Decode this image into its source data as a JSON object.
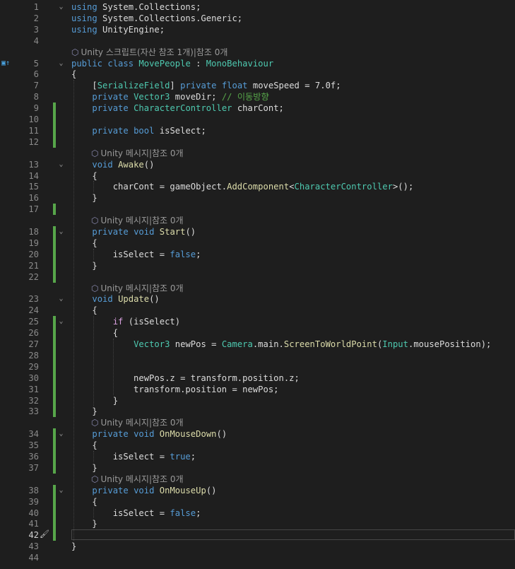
{
  "editor": {
    "current_line": 42,
    "lines": [
      {
        "n": 1,
        "t": [
          [
            "kw",
            "using"
          ],
          [
            "pl",
            " System.Collections;"
          ]
        ]
      },
      {
        "n": 2,
        "t": [
          [
            "kw",
            "using"
          ],
          [
            "pl",
            " System.Collections.Generic;"
          ]
        ]
      },
      {
        "n": 3,
        "t": [
          [
            "kw",
            "using"
          ],
          [
            "pl",
            " UnityEngine;"
          ]
        ]
      },
      {
        "n": 4,
        "t": []
      },
      {
        "lens": "Unity 스크립트(자산 참조 1개)|참조 0개",
        "indent": 0
      },
      {
        "n": 5,
        "t": [
          [
            "kw",
            "public"
          ],
          [
            "pl",
            " "
          ],
          [
            "kw",
            "class"
          ],
          [
            "pl",
            " "
          ],
          [
            "ty",
            "MovePeople"
          ],
          [
            "pl",
            " : "
          ],
          [
            "ty",
            "MonoBehaviour"
          ]
        ]
      },
      {
        "n": 6,
        "t": [
          [
            "pl",
            "{"
          ]
        ]
      },
      {
        "n": 7,
        "t": [
          [
            "pl",
            "    ["
          ],
          [
            "at",
            "SerializeField"
          ],
          [
            "pl",
            "] "
          ],
          [
            "kw",
            "private"
          ],
          [
            "pl",
            " "
          ],
          [
            "kw",
            "float"
          ],
          [
            "pl",
            " moveSpeed = 7.0f;"
          ]
        ]
      },
      {
        "n": 8,
        "t": [
          [
            "pl",
            "    "
          ],
          [
            "kw",
            "private"
          ],
          [
            "pl",
            " "
          ],
          [
            "ty",
            "Vector3"
          ],
          [
            "pl",
            " moveDir; "
          ],
          [
            "cm",
            "// 이동방향"
          ]
        ]
      },
      {
        "n": 9,
        "t": [
          [
            "pl",
            "    "
          ],
          [
            "kw",
            "private"
          ],
          [
            "pl",
            " "
          ],
          [
            "ty",
            "CharacterController"
          ],
          [
            "pl",
            " charCont;"
          ]
        ]
      },
      {
        "n": 10,
        "t": []
      },
      {
        "n": 11,
        "t": [
          [
            "pl",
            "    "
          ],
          [
            "kw",
            "private"
          ],
          [
            "pl",
            " "
          ],
          [
            "kw",
            "bool"
          ],
          [
            "pl",
            " isSelect;"
          ]
        ]
      },
      {
        "n": 12,
        "t": []
      },
      {
        "lens": "Unity 메시지|참조 0개",
        "indent": 1
      },
      {
        "n": 13,
        "t": [
          [
            "pl",
            "    "
          ],
          [
            "kw",
            "void"
          ],
          [
            "pl",
            " "
          ],
          [
            "fn",
            "Awake"
          ],
          [
            "pl",
            "()"
          ]
        ]
      },
      {
        "n": 14,
        "t": [
          [
            "pl",
            "    {"
          ]
        ]
      },
      {
        "n": 15,
        "t": [
          [
            "pl",
            "        charCont = gameObject."
          ],
          [
            "fn",
            "AddComponent"
          ],
          [
            "pl",
            "<"
          ],
          [
            "ty",
            "CharacterController"
          ],
          [
            "pl",
            ">();"
          ]
        ]
      },
      {
        "n": 16,
        "t": [
          [
            "pl",
            "    }"
          ]
        ]
      },
      {
        "n": 17,
        "t": []
      },
      {
        "lens": "Unity 메시지|참조 0개",
        "indent": 1
      },
      {
        "n": 18,
        "t": [
          [
            "pl",
            "    "
          ],
          [
            "kw",
            "private"
          ],
          [
            "pl",
            " "
          ],
          [
            "kw",
            "void"
          ],
          [
            "pl",
            " "
          ],
          [
            "fn",
            "Start"
          ],
          [
            "pl",
            "()"
          ]
        ]
      },
      {
        "n": 19,
        "t": [
          [
            "pl",
            "    {"
          ]
        ]
      },
      {
        "n": 20,
        "t": [
          [
            "pl",
            "        isSelect = "
          ],
          [
            "kw",
            "false"
          ],
          [
            "pl",
            ";"
          ]
        ]
      },
      {
        "n": 21,
        "t": [
          [
            "pl",
            "    }"
          ]
        ]
      },
      {
        "n": 22,
        "t": []
      },
      {
        "lens": "Unity 메시지|참조 0개",
        "indent": 1
      },
      {
        "n": 23,
        "t": [
          [
            "pl",
            "    "
          ],
          [
            "kw",
            "void"
          ],
          [
            "pl",
            " "
          ],
          [
            "fn",
            "Update"
          ],
          [
            "pl",
            "()"
          ]
        ]
      },
      {
        "n": 24,
        "t": [
          [
            "pl",
            "    {"
          ]
        ]
      },
      {
        "n": 25,
        "t": [
          [
            "pl",
            "        "
          ],
          [
            "ctl",
            "if"
          ],
          [
            "pl",
            " (isSelect)"
          ]
        ]
      },
      {
        "n": 26,
        "t": [
          [
            "pl",
            "        {"
          ]
        ]
      },
      {
        "n": 27,
        "t": [
          [
            "pl",
            "            "
          ],
          [
            "ty",
            "Vector3"
          ],
          [
            "pl",
            " newPos = "
          ],
          [
            "ty",
            "Camera"
          ],
          [
            "pl",
            ".main."
          ],
          [
            "fn",
            "ScreenToWorldPoint"
          ],
          [
            "pl",
            "("
          ],
          [
            "ty",
            "Input"
          ],
          [
            "pl",
            ".mousePosition);"
          ]
        ]
      },
      {
        "n": 28,
        "t": []
      },
      {
        "n": 29,
        "t": []
      },
      {
        "n": 30,
        "t": [
          [
            "pl",
            "            newPos.z = transform.position.z;"
          ]
        ]
      },
      {
        "n": 31,
        "t": [
          [
            "pl",
            "            transform.position = newPos;"
          ]
        ]
      },
      {
        "n": 32,
        "t": [
          [
            "pl",
            "        }"
          ]
        ]
      },
      {
        "n": 33,
        "t": [
          [
            "pl",
            "    }"
          ]
        ]
      },
      {
        "lens": "Unity 메시지|참조 0개",
        "indent": 1
      },
      {
        "n": 34,
        "t": [
          [
            "pl",
            "    "
          ],
          [
            "kw",
            "private"
          ],
          [
            "pl",
            " "
          ],
          [
            "kw",
            "void"
          ],
          [
            "pl",
            " "
          ],
          [
            "fn",
            "OnMouseDown"
          ],
          [
            "pl",
            "()"
          ]
        ]
      },
      {
        "n": 35,
        "t": [
          [
            "pl",
            "    {"
          ]
        ]
      },
      {
        "n": 36,
        "t": [
          [
            "pl",
            "        isSelect = "
          ],
          [
            "kw",
            "true"
          ],
          [
            "pl",
            ";"
          ]
        ]
      },
      {
        "n": 37,
        "t": [
          [
            "pl",
            "    }"
          ]
        ]
      },
      {
        "lens": "Unity 메시지|참조 0개",
        "indent": 1
      },
      {
        "n": 38,
        "t": [
          [
            "pl",
            "    "
          ],
          [
            "kw",
            "private"
          ],
          [
            "pl",
            " "
          ],
          [
            "kw",
            "void"
          ],
          [
            "pl",
            " "
          ],
          [
            "fn",
            "OnMouseUp"
          ],
          [
            "pl",
            "()"
          ]
        ]
      },
      {
        "n": 39,
        "t": [
          [
            "pl",
            "    {"
          ]
        ]
      },
      {
        "n": 40,
        "t": [
          [
            "pl",
            "        isSelect = "
          ],
          [
            "kw",
            "false"
          ],
          [
            "pl",
            ";"
          ]
        ]
      },
      {
        "n": 41,
        "t": [
          [
            "pl",
            "    }"
          ]
        ]
      },
      {
        "n": 42,
        "t": []
      },
      {
        "n": 43,
        "t": [
          [
            "pl",
            "}"
          ]
        ]
      },
      {
        "n": 44,
        "t": []
      }
    ],
    "changed_lines": [
      9,
      10,
      11,
      12,
      17,
      18,
      19,
      20,
      21,
      22,
      25,
      26,
      27,
      28,
      29,
      30,
      31,
      32,
      33,
      34,
      35,
      36,
      37,
      38,
      39,
      40,
      41,
      42
    ],
    "fold_lines": [
      1,
      5,
      13,
      18,
      23,
      25,
      34,
      38
    ],
    "icons": {
      "lens": "unity-cube-icon",
      "fold": "collapse-chevron-icon",
      "override": "override-marker-icon",
      "quick_action": "screwdriver-brush-icon"
    }
  }
}
